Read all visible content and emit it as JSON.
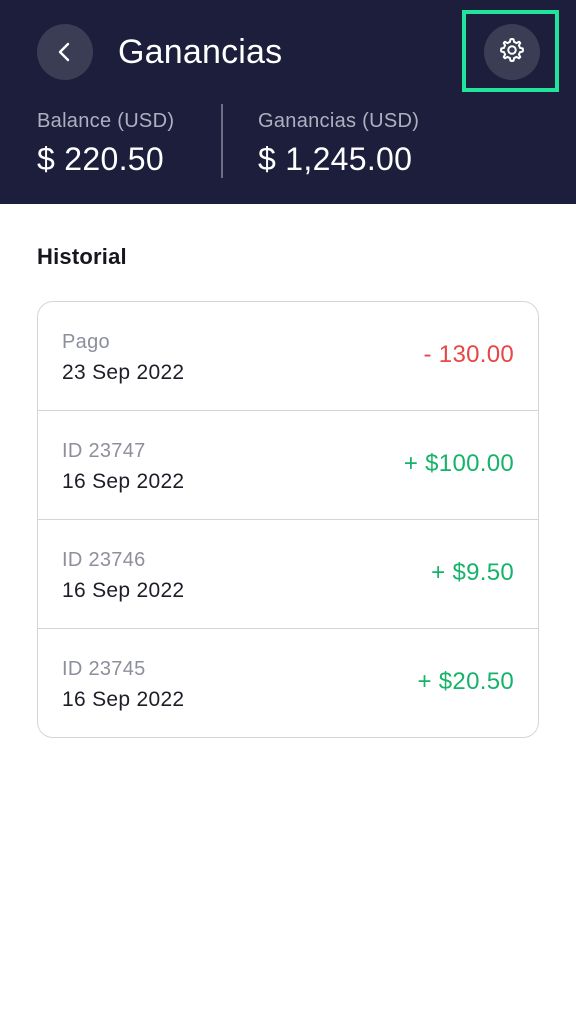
{
  "header": {
    "title": "Ganancias",
    "back_icon": "chevron-left-icon",
    "settings_icon": "gear-icon",
    "highlight_color": "#22e39b",
    "background_color": "#1c1e3c"
  },
  "stats": {
    "balance": {
      "label": "Balance (USD)",
      "value": "$ 220.50"
    },
    "earnings": {
      "label": "Ganancias (USD)",
      "value": "$ 1,245.00"
    }
  },
  "history": {
    "title": "Historial",
    "rows": [
      {
        "label": "Pago",
        "date": "23 Sep 2022",
        "amount": "- 130.00",
        "type": "negative"
      },
      {
        "label": "ID 23747",
        "date": "16 Sep 2022",
        "amount": "+ $100.00",
        "type": "positive"
      },
      {
        "label": "ID 23746",
        "date": "16 Sep 2022",
        "amount": "+ $9.50",
        "type": "positive"
      },
      {
        "label": "ID 23745",
        "date": "16 Sep 2022",
        "amount": "+ $20.50",
        "type": "positive"
      }
    ]
  },
  "colors": {
    "negative": "#e84545",
    "positive": "#16b36a"
  }
}
